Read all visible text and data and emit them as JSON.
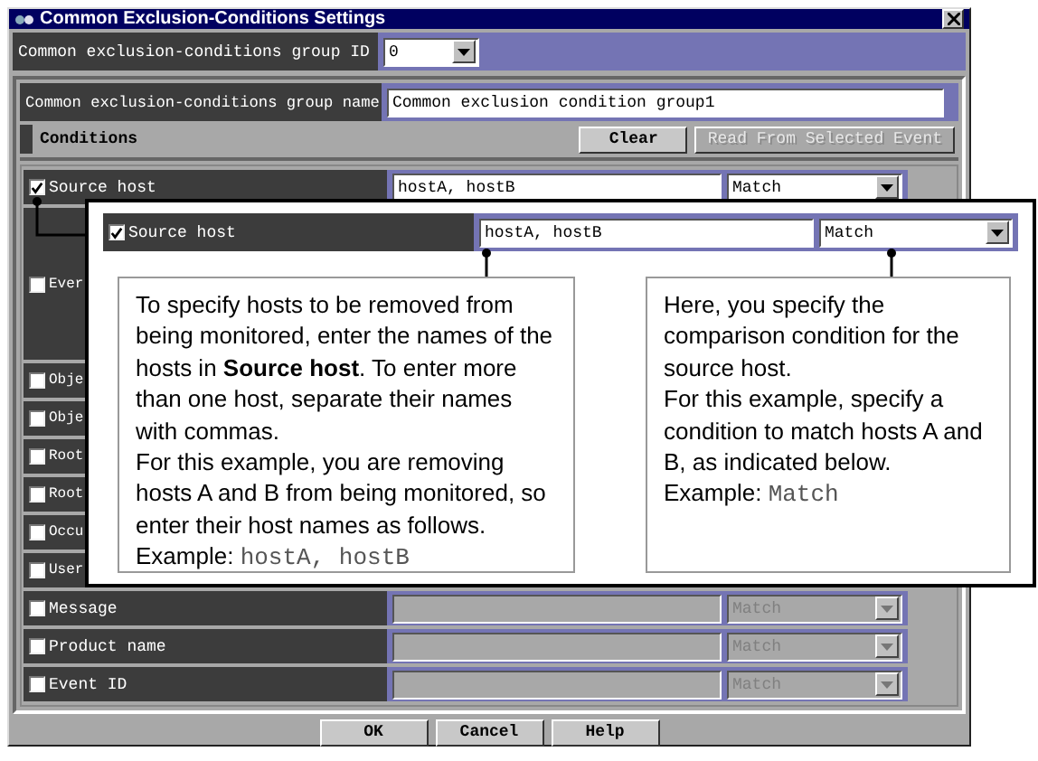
{
  "window": {
    "title": "Common Exclusion-Conditions Settings"
  },
  "group_id": {
    "label": "Common exclusion-conditions group ID",
    "value": "0"
  },
  "group_name": {
    "label": "Common exclusion-conditions group name",
    "value": "Common exclusion condition group1"
  },
  "conditions": {
    "title": "Conditions",
    "buttons": [
      {
        "label": "Clear",
        "disabled": false
      },
      {
        "label": "Read From Selected Event",
        "disabled": true
      }
    ]
  },
  "rows": [
    {
      "kind": "field",
      "label": "Source host",
      "checked": true,
      "value": "hostA, hostB",
      "match": "Match",
      "disabled": false
    },
    {
      "kind": "tall",
      "label": "Ever",
      "checked": false
    },
    {
      "kind": "covered",
      "label": "Obje",
      "checked": false
    },
    {
      "kind": "covered",
      "label": "Obje",
      "checked": false
    },
    {
      "kind": "covered",
      "label": "Root",
      "checked": false
    },
    {
      "kind": "covered",
      "label": "Root",
      "checked": false
    },
    {
      "kind": "covered",
      "label": "Occu",
      "checked": false
    },
    {
      "kind": "covered",
      "label": "User",
      "checked": false
    },
    {
      "kind": "field",
      "label": "Message",
      "checked": false,
      "match": "Match",
      "disabled": true
    },
    {
      "kind": "field",
      "label": "Product name",
      "checked": false,
      "match": "Match",
      "disabled": true
    },
    {
      "kind": "field",
      "label": "Event ID",
      "checked": false,
      "match": "Match",
      "disabled": true
    }
  ],
  "buttons": [
    "OK",
    "Cancel",
    "Help"
  ],
  "callout": {
    "row": {
      "label": "Source host",
      "checked": true,
      "value": "hostA, hostB",
      "match": "Match"
    },
    "notes": [
      {
        "paragraphs": [
          "To specify hosts to be removed from being monitored, enter the names of the hosts in **Source host**. To enter more than one host, separate their names with commas.",
          "For this example, you are removing hosts A and B from being monitored, so enter their host names as follows."
        ],
        "example_label": "Example:",
        "example": "hostA, hostB"
      },
      {
        "paragraphs": [
          "Here, you specify the comparison condition for the source host.",
          "For this example, specify a condition to match hosts A and B, as indicated below."
        ],
        "example_label": "Example:",
        "example": "Match"
      }
    ]
  }
}
